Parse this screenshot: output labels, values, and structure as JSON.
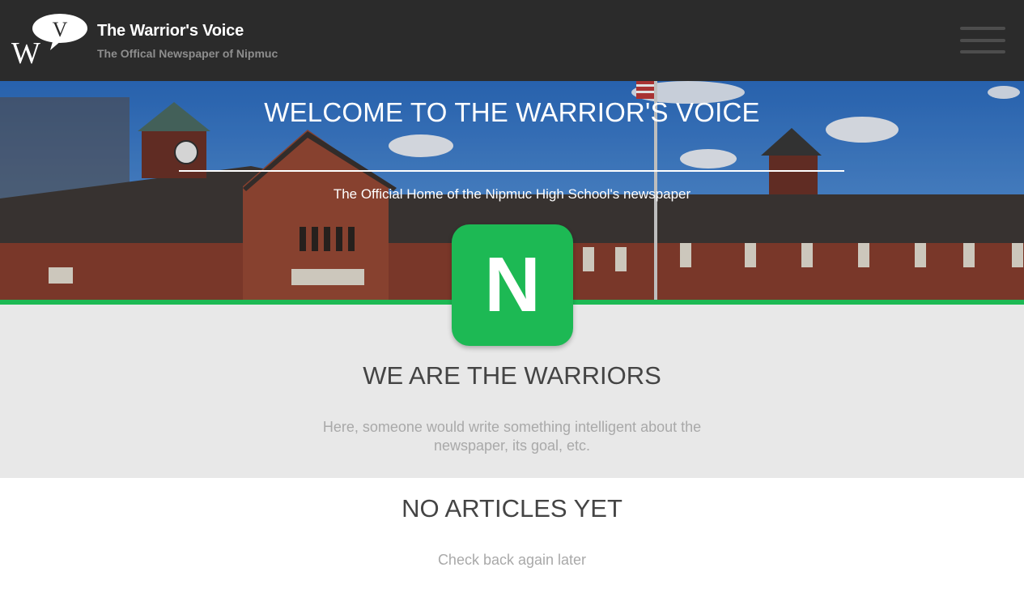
{
  "header": {
    "logo_letters": "WV",
    "site_title": "The Warrior's Voice",
    "site_subtitle": "The Offical Newspaper of Nipmuc",
    "menu_icon": "hamburger-menu-icon"
  },
  "hero": {
    "title": "WELCOME TO THE WARRIOR'S VOICE",
    "subtitle": "The Official Home of the Nipmuc High School's newspaper"
  },
  "badge": {
    "letter": "N"
  },
  "about": {
    "title": "WE ARE THE WARRIORS",
    "text": "Here, someone would write something intelligent about the newspaper, its goal, etc."
  },
  "articles": {
    "title": "NO ARTICLES YET",
    "text": "Check back again later"
  },
  "colors": {
    "header_bg": "#2b2b2b",
    "accent_green": "#1db954",
    "about_bg": "#e8e8e8",
    "heading_text": "#444444",
    "muted_text": "#a9a9a9"
  }
}
